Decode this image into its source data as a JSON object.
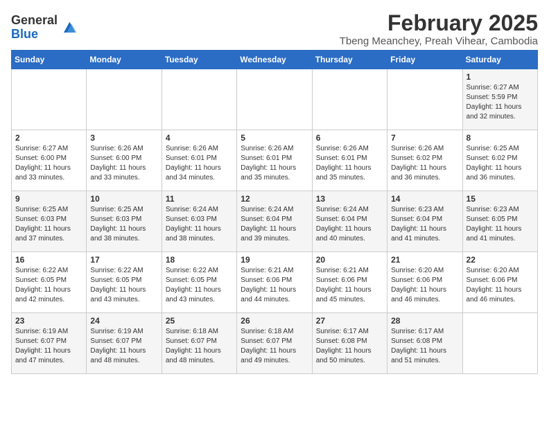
{
  "logo": {
    "general": "General",
    "blue": "Blue"
  },
  "title": {
    "month": "February 2025",
    "location": "Tbeng Meanchey, Preah Vihear, Cambodia"
  },
  "weekdays": [
    "Sunday",
    "Monday",
    "Tuesday",
    "Wednesday",
    "Thursday",
    "Friday",
    "Saturday"
  ],
  "weeks": [
    [
      {
        "day": "",
        "info": ""
      },
      {
        "day": "",
        "info": ""
      },
      {
        "day": "",
        "info": ""
      },
      {
        "day": "",
        "info": ""
      },
      {
        "day": "",
        "info": ""
      },
      {
        "day": "",
        "info": ""
      },
      {
        "day": "1",
        "info": "Sunrise: 6:27 AM\nSunset: 5:59 PM\nDaylight: 11 hours and 32 minutes."
      }
    ],
    [
      {
        "day": "2",
        "info": "Sunrise: 6:27 AM\nSunset: 6:00 PM\nDaylight: 11 hours and 33 minutes."
      },
      {
        "day": "3",
        "info": "Sunrise: 6:26 AM\nSunset: 6:00 PM\nDaylight: 11 hours and 33 minutes."
      },
      {
        "day": "4",
        "info": "Sunrise: 6:26 AM\nSunset: 6:01 PM\nDaylight: 11 hours and 34 minutes."
      },
      {
        "day": "5",
        "info": "Sunrise: 6:26 AM\nSunset: 6:01 PM\nDaylight: 11 hours and 35 minutes."
      },
      {
        "day": "6",
        "info": "Sunrise: 6:26 AM\nSunset: 6:01 PM\nDaylight: 11 hours and 35 minutes."
      },
      {
        "day": "7",
        "info": "Sunrise: 6:26 AM\nSunset: 6:02 PM\nDaylight: 11 hours and 36 minutes."
      },
      {
        "day": "8",
        "info": "Sunrise: 6:25 AM\nSunset: 6:02 PM\nDaylight: 11 hours and 36 minutes."
      }
    ],
    [
      {
        "day": "9",
        "info": "Sunrise: 6:25 AM\nSunset: 6:03 PM\nDaylight: 11 hours and 37 minutes."
      },
      {
        "day": "10",
        "info": "Sunrise: 6:25 AM\nSunset: 6:03 PM\nDaylight: 11 hours and 38 minutes."
      },
      {
        "day": "11",
        "info": "Sunrise: 6:24 AM\nSunset: 6:03 PM\nDaylight: 11 hours and 38 minutes."
      },
      {
        "day": "12",
        "info": "Sunrise: 6:24 AM\nSunset: 6:04 PM\nDaylight: 11 hours and 39 minutes."
      },
      {
        "day": "13",
        "info": "Sunrise: 6:24 AM\nSunset: 6:04 PM\nDaylight: 11 hours and 40 minutes."
      },
      {
        "day": "14",
        "info": "Sunrise: 6:23 AM\nSunset: 6:04 PM\nDaylight: 11 hours and 41 minutes."
      },
      {
        "day": "15",
        "info": "Sunrise: 6:23 AM\nSunset: 6:05 PM\nDaylight: 11 hours and 41 minutes."
      }
    ],
    [
      {
        "day": "16",
        "info": "Sunrise: 6:22 AM\nSunset: 6:05 PM\nDaylight: 11 hours and 42 minutes."
      },
      {
        "day": "17",
        "info": "Sunrise: 6:22 AM\nSunset: 6:05 PM\nDaylight: 11 hours and 43 minutes."
      },
      {
        "day": "18",
        "info": "Sunrise: 6:22 AM\nSunset: 6:05 PM\nDaylight: 11 hours and 43 minutes."
      },
      {
        "day": "19",
        "info": "Sunrise: 6:21 AM\nSunset: 6:06 PM\nDaylight: 11 hours and 44 minutes."
      },
      {
        "day": "20",
        "info": "Sunrise: 6:21 AM\nSunset: 6:06 PM\nDaylight: 11 hours and 45 minutes."
      },
      {
        "day": "21",
        "info": "Sunrise: 6:20 AM\nSunset: 6:06 PM\nDaylight: 11 hours and 46 minutes."
      },
      {
        "day": "22",
        "info": "Sunrise: 6:20 AM\nSunset: 6:06 PM\nDaylight: 11 hours and 46 minutes."
      }
    ],
    [
      {
        "day": "23",
        "info": "Sunrise: 6:19 AM\nSunset: 6:07 PM\nDaylight: 11 hours and 47 minutes."
      },
      {
        "day": "24",
        "info": "Sunrise: 6:19 AM\nSunset: 6:07 PM\nDaylight: 11 hours and 48 minutes."
      },
      {
        "day": "25",
        "info": "Sunrise: 6:18 AM\nSunset: 6:07 PM\nDaylight: 11 hours and 48 minutes."
      },
      {
        "day": "26",
        "info": "Sunrise: 6:18 AM\nSunset: 6:07 PM\nDaylight: 11 hours and 49 minutes."
      },
      {
        "day": "27",
        "info": "Sunrise: 6:17 AM\nSunset: 6:08 PM\nDaylight: 11 hours and 50 minutes."
      },
      {
        "day": "28",
        "info": "Sunrise: 6:17 AM\nSunset: 6:08 PM\nDaylight: 11 hours and 51 minutes."
      },
      {
        "day": "",
        "info": ""
      }
    ]
  ]
}
